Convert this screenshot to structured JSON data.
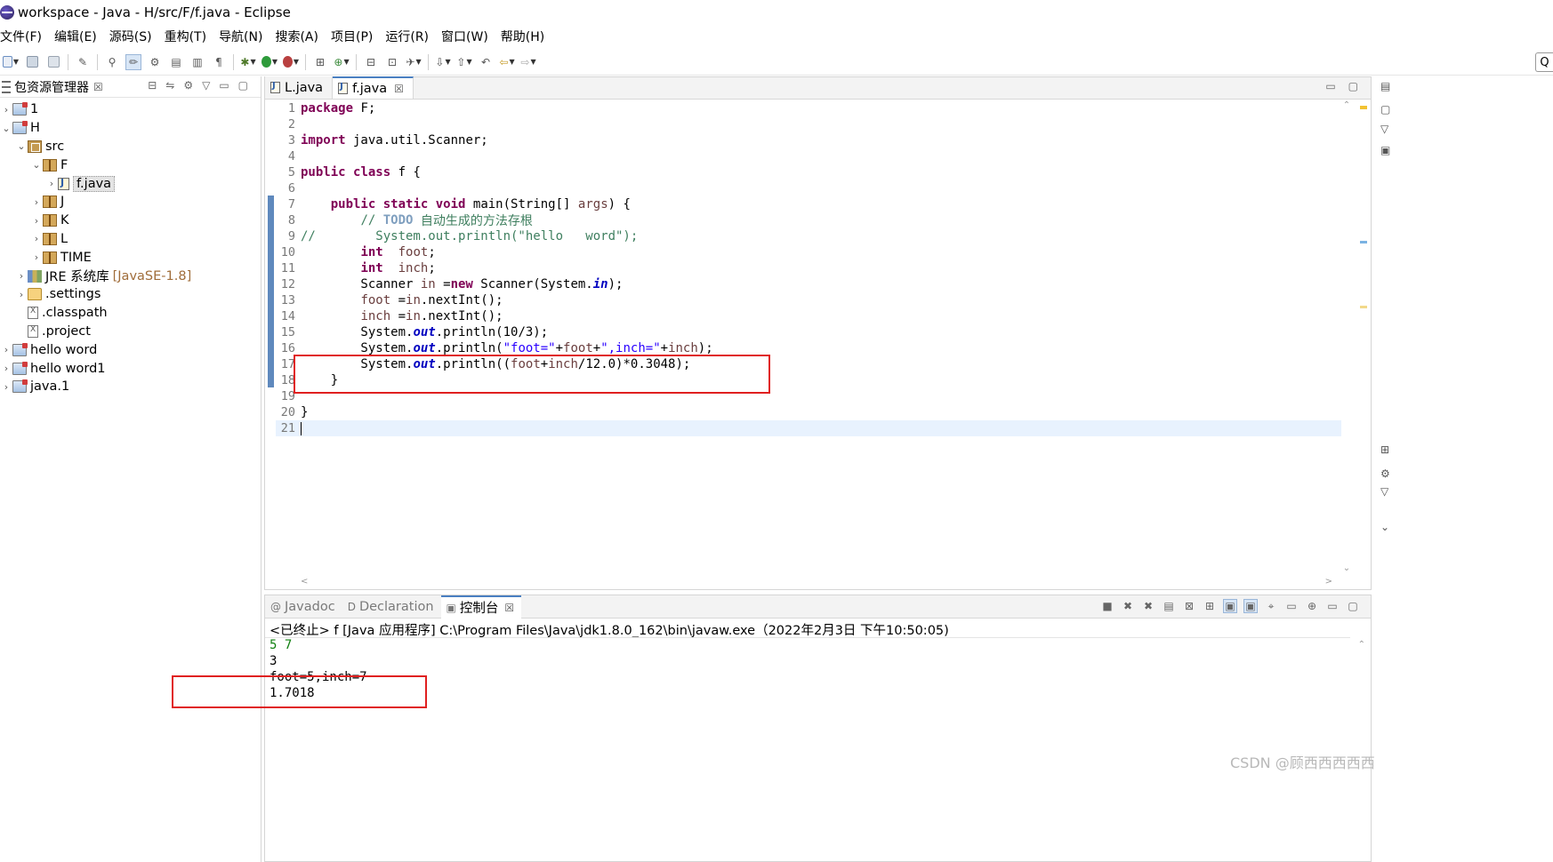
{
  "window": {
    "title": "workspace - Java - H/src/F/f.java - Eclipse"
  },
  "menu": [
    "文件(F)",
    "编辑(E)",
    "源码(S)",
    "重构(T)",
    "导航(N)",
    "搜索(A)",
    "项目(P)",
    "运行(R)",
    "窗口(W)",
    "帮助(H)"
  ],
  "package_explorer": {
    "title": "包资源管理器",
    "items": [
      {
        "label": "1",
        "depth": 0,
        "expanded": false,
        "icon": "project-icon"
      },
      {
        "label": "H",
        "depth": 0,
        "expanded": true,
        "icon": "project-icon"
      },
      {
        "label": "src",
        "depth": 1,
        "expanded": true,
        "icon": "source-folder-icon"
      },
      {
        "label": "F",
        "depth": 2,
        "expanded": true,
        "icon": "package-icon"
      },
      {
        "label": "f.java",
        "depth": 3,
        "expanded": false,
        "icon": "java-file-icon",
        "selected": true
      },
      {
        "label": "J",
        "depth": 2,
        "expanded": false,
        "icon": "package-icon"
      },
      {
        "label": "K",
        "depth": 2,
        "expanded": false,
        "icon": "package-icon"
      },
      {
        "label": "L",
        "depth": 2,
        "expanded": false,
        "icon": "package-icon"
      },
      {
        "label": "TIME",
        "depth": 2,
        "expanded": false,
        "icon": "package-icon"
      },
      {
        "label": "JRE 系统库",
        "suffix": "[JavaSE-1.8]",
        "depth": 1,
        "expanded": false,
        "icon": "library-icon"
      },
      {
        "label": ".settings",
        "depth": 1,
        "expanded": false,
        "icon": "folder-icon"
      },
      {
        "label": ".classpath",
        "depth": 1,
        "icon": "file-icon"
      },
      {
        "label": ".project",
        "depth": 1,
        "icon": "file-icon"
      },
      {
        "label": "hello word",
        "depth": 0,
        "expanded": false,
        "icon": "project-icon"
      },
      {
        "label": "hello word1",
        "depth": 0,
        "expanded": false,
        "icon": "project-icon"
      },
      {
        "label": "java.1",
        "depth": 0,
        "expanded": false,
        "icon": "project-icon"
      }
    ]
  },
  "editor": {
    "tabs": [
      {
        "label": "L.java",
        "active": false
      },
      {
        "label": "f.java",
        "active": true
      }
    ],
    "current_line": 21,
    "lines": [
      [
        {
          "k": "kw",
          "t": "package"
        },
        {
          "t": " F;"
        }
      ],
      [],
      [
        {
          "k": "kw",
          "t": "import"
        },
        {
          "t": " java.util.Scanner;"
        }
      ],
      [],
      [
        {
          "k": "kw",
          "t": "public"
        },
        {
          "t": " "
        },
        {
          "k": "kw",
          "t": "class"
        },
        {
          "t": " f {"
        }
      ],
      [],
      [
        {
          "t": "    "
        },
        {
          "k": "kw",
          "t": "public"
        },
        {
          "t": " "
        },
        {
          "k": "kw",
          "t": "static"
        },
        {
          "t": " "
        },
        {
          "k": "kw",
          "t": "void"
        },
        {
          "t": " main(String[] "
        },
        {
          "k": "vr",
          "t": "args"
        },
        {
          "t": ") {"
        }
      ],
      [
        {
          "t": "        "
        },
        {
          "k": "cm",
          "t": "// "
        },
        {
          "k": "tg",
          "t": "TODO"
        },
        {
          "k": "cm",
          "t": " 自动生成的方法存根"
        }
      ],
      [
        {
          "k": "cm",
          "t": "//        System.out.println(\"hello   word\");"
        }
      ],
      [
        {
          "t": "        "
        },
        {
          "k": "kw",
          "t": "int"
        },
        {
          "t": "  "
        },
        {
          "k": "vr",
          "t": "foot"
        },
        {
          "t": ";"
        }
      ],
      [
        {
          "t": "        "
        },
        {
          "k": "kw",
          "t": "int"
        },
        {
          "t": "  "
        },
        {
          "k": "vr",
          "t": "inch"
        },
        {
          "t": ";"
        }
      ],
      [
        {
          "t": "        Scanner "
        },
        {
          "k": "vr",
          "t": "in"
        },
        {
          "t": " ="
        },
        {
          "k": "kw",
          "t": "new"
        },
        {
          "t": " Scanner(System."
        },
        {
          "k": "fld",
          "t": "in"
        },
        {
          "t": ");"
        }
      ],
      [
        {
          "t": "        "
        },
        {
          "k": "vr",
          "t": "foot"
        },
        {
          "t": " ="
        },
        {
          "k": "vr",
          "t": "in"
        },
        {
          "t": ".nextInt();"
        }
      ],
      [
        {
          "t": "        "
        },
        {
          "k": "vr",
          "t": "inch"
        },
        {
          "t": " ="
        },
        {
          "k": "vr",
          "t": "in"
        },
        {
          "t": ".nextInt();"
        }
      ],
      [
        {
          "t": "        System."
        },
        {
          "k": "fld",
          "t": "out"
        },
        {
          "t": ".println(10/3);"
        }
      ],
      [
        {
          "t": "        System."
        },
        {
          "k": "fld",
          "t": "out"
        },
        {
          "t": ".println("
        },
        {
          "k": "str",
          "t": "\"foot=\""
        },
        {
          "t": "+"
        },
        {
          "k": "vr",
          "t": "foot"
        },
        {
          "t": "+"
        },
        {
          "k": "str",
          "t": "\",inch=\""
        },
        {
          "t": "+"
        },
        {
          "k": "vr",
          "t": "inch"
        },
        {
          "t": ");"
        }
      ],
      [
        {
          "t": "        System."
        },
        {
          "k": "fld",
          "t": "out"
        },
        {
          "t": ".println(("
        },
        {
          "k": "vr",
          "t": "foot"
        },
        {
          "t": "+"
        },
        {
          "k": "vr",
          "t": "inch"
        },
        {
          "t": "/12.0)*0.3048);"
        }
      ],
      [
        {
          "t": "    }"
        }
      ],
      [],
      [
        {
          "t": "}"
        }
      ],
      []
    ]
  },
  "console": {
    "tabs": [
      {
        "label": "Javadoc",
        "icon": "@",
        "active": false
      },
      {
        "label": "Declaration",
        "icon": "D",
        "active": false
      },
      {
        "label": "控制台",
        "icon": "▣",
        "active": true
      }
    ],
    "terminated": "<已终止> f [Java 应用程序] C:\\Program Files\\Java\\jdk1.8.0_162\\bin\\javaw.exe（2022年2月3日 下午10:50:05)",
    "input_line": "5 7",
    "output": [
      "3",
      "foot=5,inch=7",
      "1.7018"
    ]
  },
  "watermark": "CSDN @顾西西西西西"
}
